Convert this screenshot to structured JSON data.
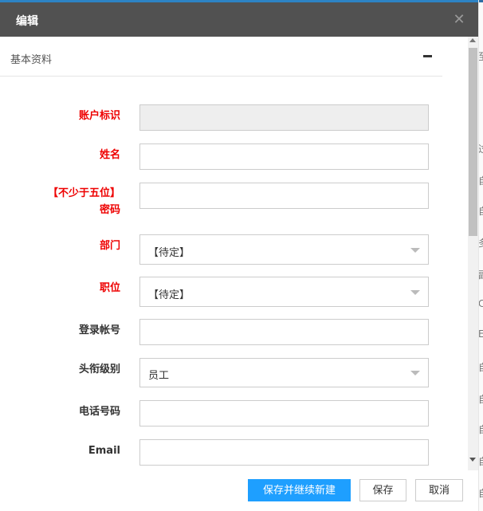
{
  "dialog": {
    "title": "编辑",
    "close_icon": "close-icon"
  },
  "section": {
    "title": "基本资料",
    "collapse_icon": "minus-icon"
  },
  "fields": {
    "account_id": {
      "label": "账户标识",
      "value": ""
    },
    "name": {
      "label": "姓名",
      "value": ""
    },
    "password": {
      "label_line1": "【不少于五位】",
      "label_line2": "密码",
      "value": ""
    },
    "department": {
      "label": "部门",
      "value": "【待定】"
    },
    "position": {
      "label": "职位",
      "value": "【待定】"
    },
    "login_account": {
      "label": "登录帐号",
      "value": ""
    },
    "title_level": {
      "label": "头衔级别",
      "value": "员工"
    },
    "phone": {
      "label": "电话号码",
      "value": ""
    },
    "email": {
      "label": "Email",
      "value": ""
    }
  },
  "buttons": {
    "save_and_new": "保存并继续新建",
    "save": "保存",
    "cancel": "取消"
  },
  "background_chars": [
    "至",
    "过",
    "自",
    "自",
    "多",
    "副",
    "C",
    "E",
    "自",
    "自",
    "自",
    "自",
    "自",
    "C"
  ],
  "colors": {
    "titlebar": "#515151",
    "required_label": "#ee0000",
    "primary_button": "#1e9fff"
  }
}
